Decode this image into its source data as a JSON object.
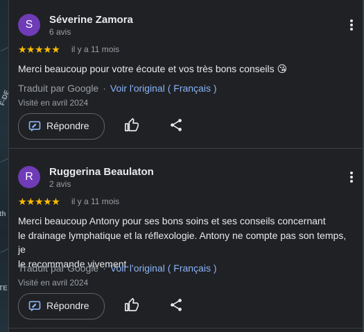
{
  "map_fragments": [
    "F-DE",
    "th",
    "TE"
  ],
  "reviews": [
    {
      "avatar_letter": "S",
      "avatar_color": "#6f3bb7",
      "name": "Séverine Zamora",
      "count": "6 avis",
      "stars": "★★★★★",
      "rating": 5,
      "time": "il y a 11 mois",
      "text": "Merci beaucoup pour votre écoute et vos très bons conseils 😘",
      "translated_by": "Traduit par Google",
      "separator": "·",
      "see_original": "Voir l'original ( Français )",
      "visited": "Visité en avril 2024",
      "reply_label": "Répondre"
    },
    {
      "avatar_letter": "R",
      "avatar_color": "#6f3bb7",
      "name": "Ruggerina Beaulaton",
      "count": "2 avis",
      "stars": "★★★★★",
      "rating": 5,
      "time": "il y a 11 mois",
      "text_lines": [
        "Merci beaucoup Antony pour ses bons soins et ses conseils concernant",
        "le drainage lymphatique et la réflexologie. Antony ne compte pas son temps, je",
        "le recommande vivement."
      ],
      "translated_by": "Traduit par Google",
      "separator": "·",
      "see_original": "Voir l'original ( Français )",
      "visited": "Visité en avril 2024",
      "reply_label": "Répondre"
    }
  ],
  "colors": {
    "background": "#202124",
    "star": "#fbbc04",
    "link": "#8ab4f8",
    "muted": "#9aa0a6",
    "text": "#e8eaed"
  },
  "icons": [
    "more-vert-icon",
    "reply-icon",
    "thumb-up-icon",
    "share-icon"
  ]
}
